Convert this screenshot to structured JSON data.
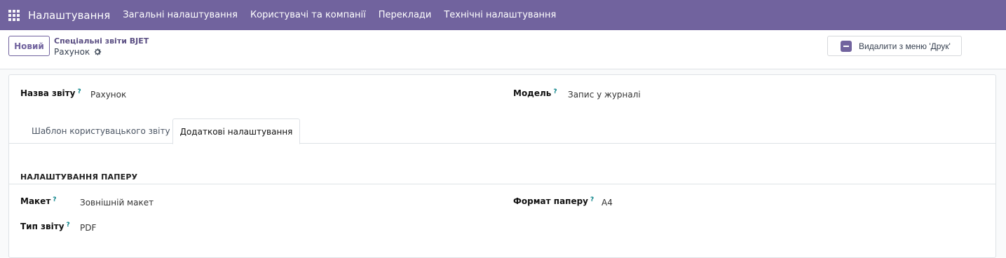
{
  "topbar": {
    "app_title": "Налаштування",
    "menu": [
      "Загальні налаштування",
      "Користувачі та компанії",
      "Переклади",
      "Технічні налаштування"
    ],
    "bg_color": "#71639e"
  },
  "control": {
    "new_label": "Новий",
    "breadcrumb_parent": "Спеціальні звіти BJET",
    "breadcrumb_current": "Рахунок",
    "remove_label": "Видалити з меню 'Друк'"
  },
  "form": {
    "report_name_label": "Назва звіту",
    "report_name_value": "Рахунок",
    "model_label": "Модель",
    "model_value": "Запис у журналі",
    "tooltip_mark": "?",
    "tabs": [
      "Шаблон користувацького звіту",
      "Додаткові налаштування"
    ],
    "active_tab": "Додаткові налаштування",
    "section_title": "НАЛАШТУВАННЯ ПАПЕРУ",
    "layout_label": "Макет",
    "layout_value": "Зовнішній макет",
    "report_type_label": "Тип звіту",
    "report_type_value": "PDF",
    "paper_format_label": "Формат паперу",
    "paper_format_value": "A4"
  }
}
